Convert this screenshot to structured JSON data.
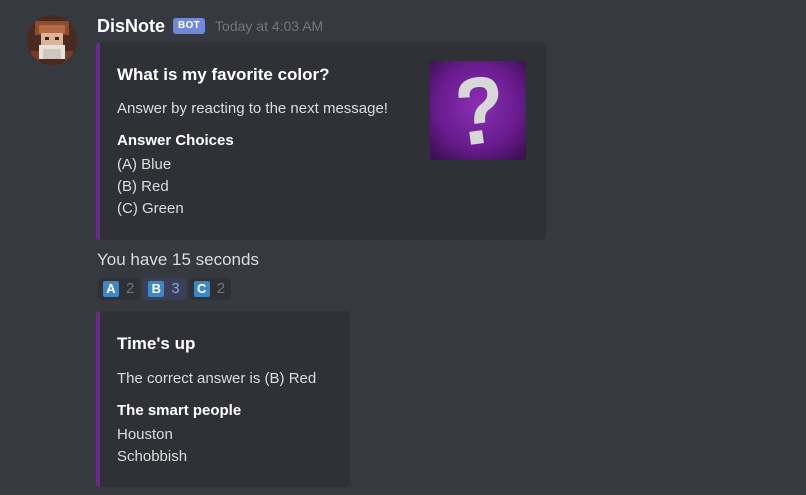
{
  "message": {
    "author": "DisNote",
    "bot_tag": "BOT",
    "timestamp": "Today at 4:03 AM",
    "avatar_icon": "pixel-avatar-icon"
  },
  "embed_question": {
    "accent_color": "#6a2c8a",
    "title": "What is my favorite color?",
    "description": "Answer by reacting to the next message!",
    "field_name": "Answer Choices",
    "choices": [
      "(A) Blue",
      "(B) Red",
      "(C) Green"
    ],
    "thumbnail_icon": "question-mark-icon"
  },
  "timer_text": "You have 15 seconds",
  "reactions": [
    {
      "letter": "A",
      "count": "2",
      "reacted": false,
      "icon": "regional-indicator-a-icon"
    },
    {
      "letter": "B",
      "count": "3",
      "reacted": true,
      "icon": "regional-indicator-b-icon"
    },
    {
      "letter": "C",
      "count": "2",
      "reacted": false,
      "icon": "regional-indicator-c-icon"
    }
  ],
  "embed_result": {
    "accent_color": "#6a2c8a",
    "title": "Time's up",
    "description": "The correct answer is (B) Red",
    "field_name": "The smart people",
    "people": [
      "Houston",
      "Schobbish"
    ]
  }
}
